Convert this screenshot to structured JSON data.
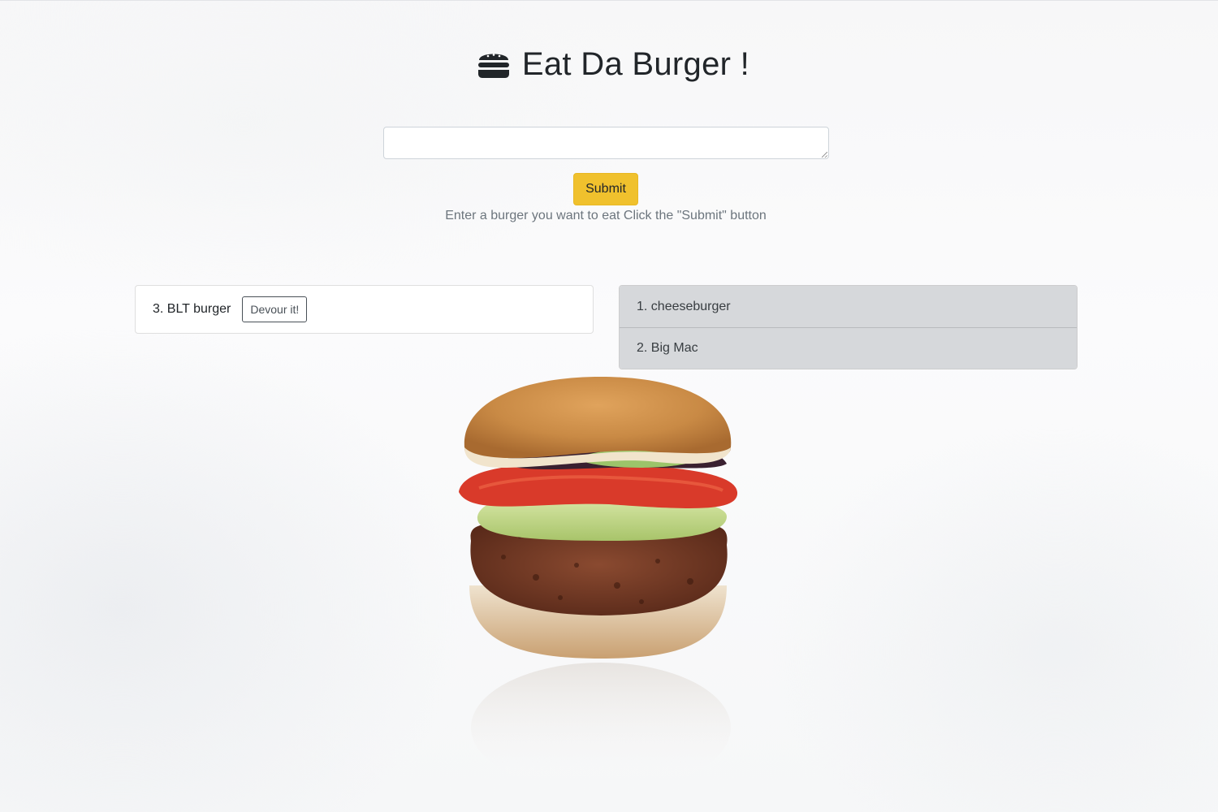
{
  "header": {
    "title": "Eat Da Burger !",
    "icon": "hamburger-icon"
  },
  "form": {
    "input_value": "",
    "submit_label": "Submit",
    "hint": "Enter a burger you want to eat Click the \"Submit\" button"
  },
  "uneaten": {
    "items": [
      {
        "label": "3. BLT burger",
        "button_label": "Devour it!"
      }
    ]
  },
  "devoured": {
    "items": [
      {
        "label": "1. cheeseburger"
      },
      {
        "label": "2. Big Mac"
      }
    ]
  },
  "colors": {
    "submit_bg": "#f0c12d",
    "devoured_bg": "#d6d8db",
    "title_text": "#212529",
    "hint_text": "#6c757d"
  },
  "image": {
    "subject": "veggie burger photo"
  }
}
